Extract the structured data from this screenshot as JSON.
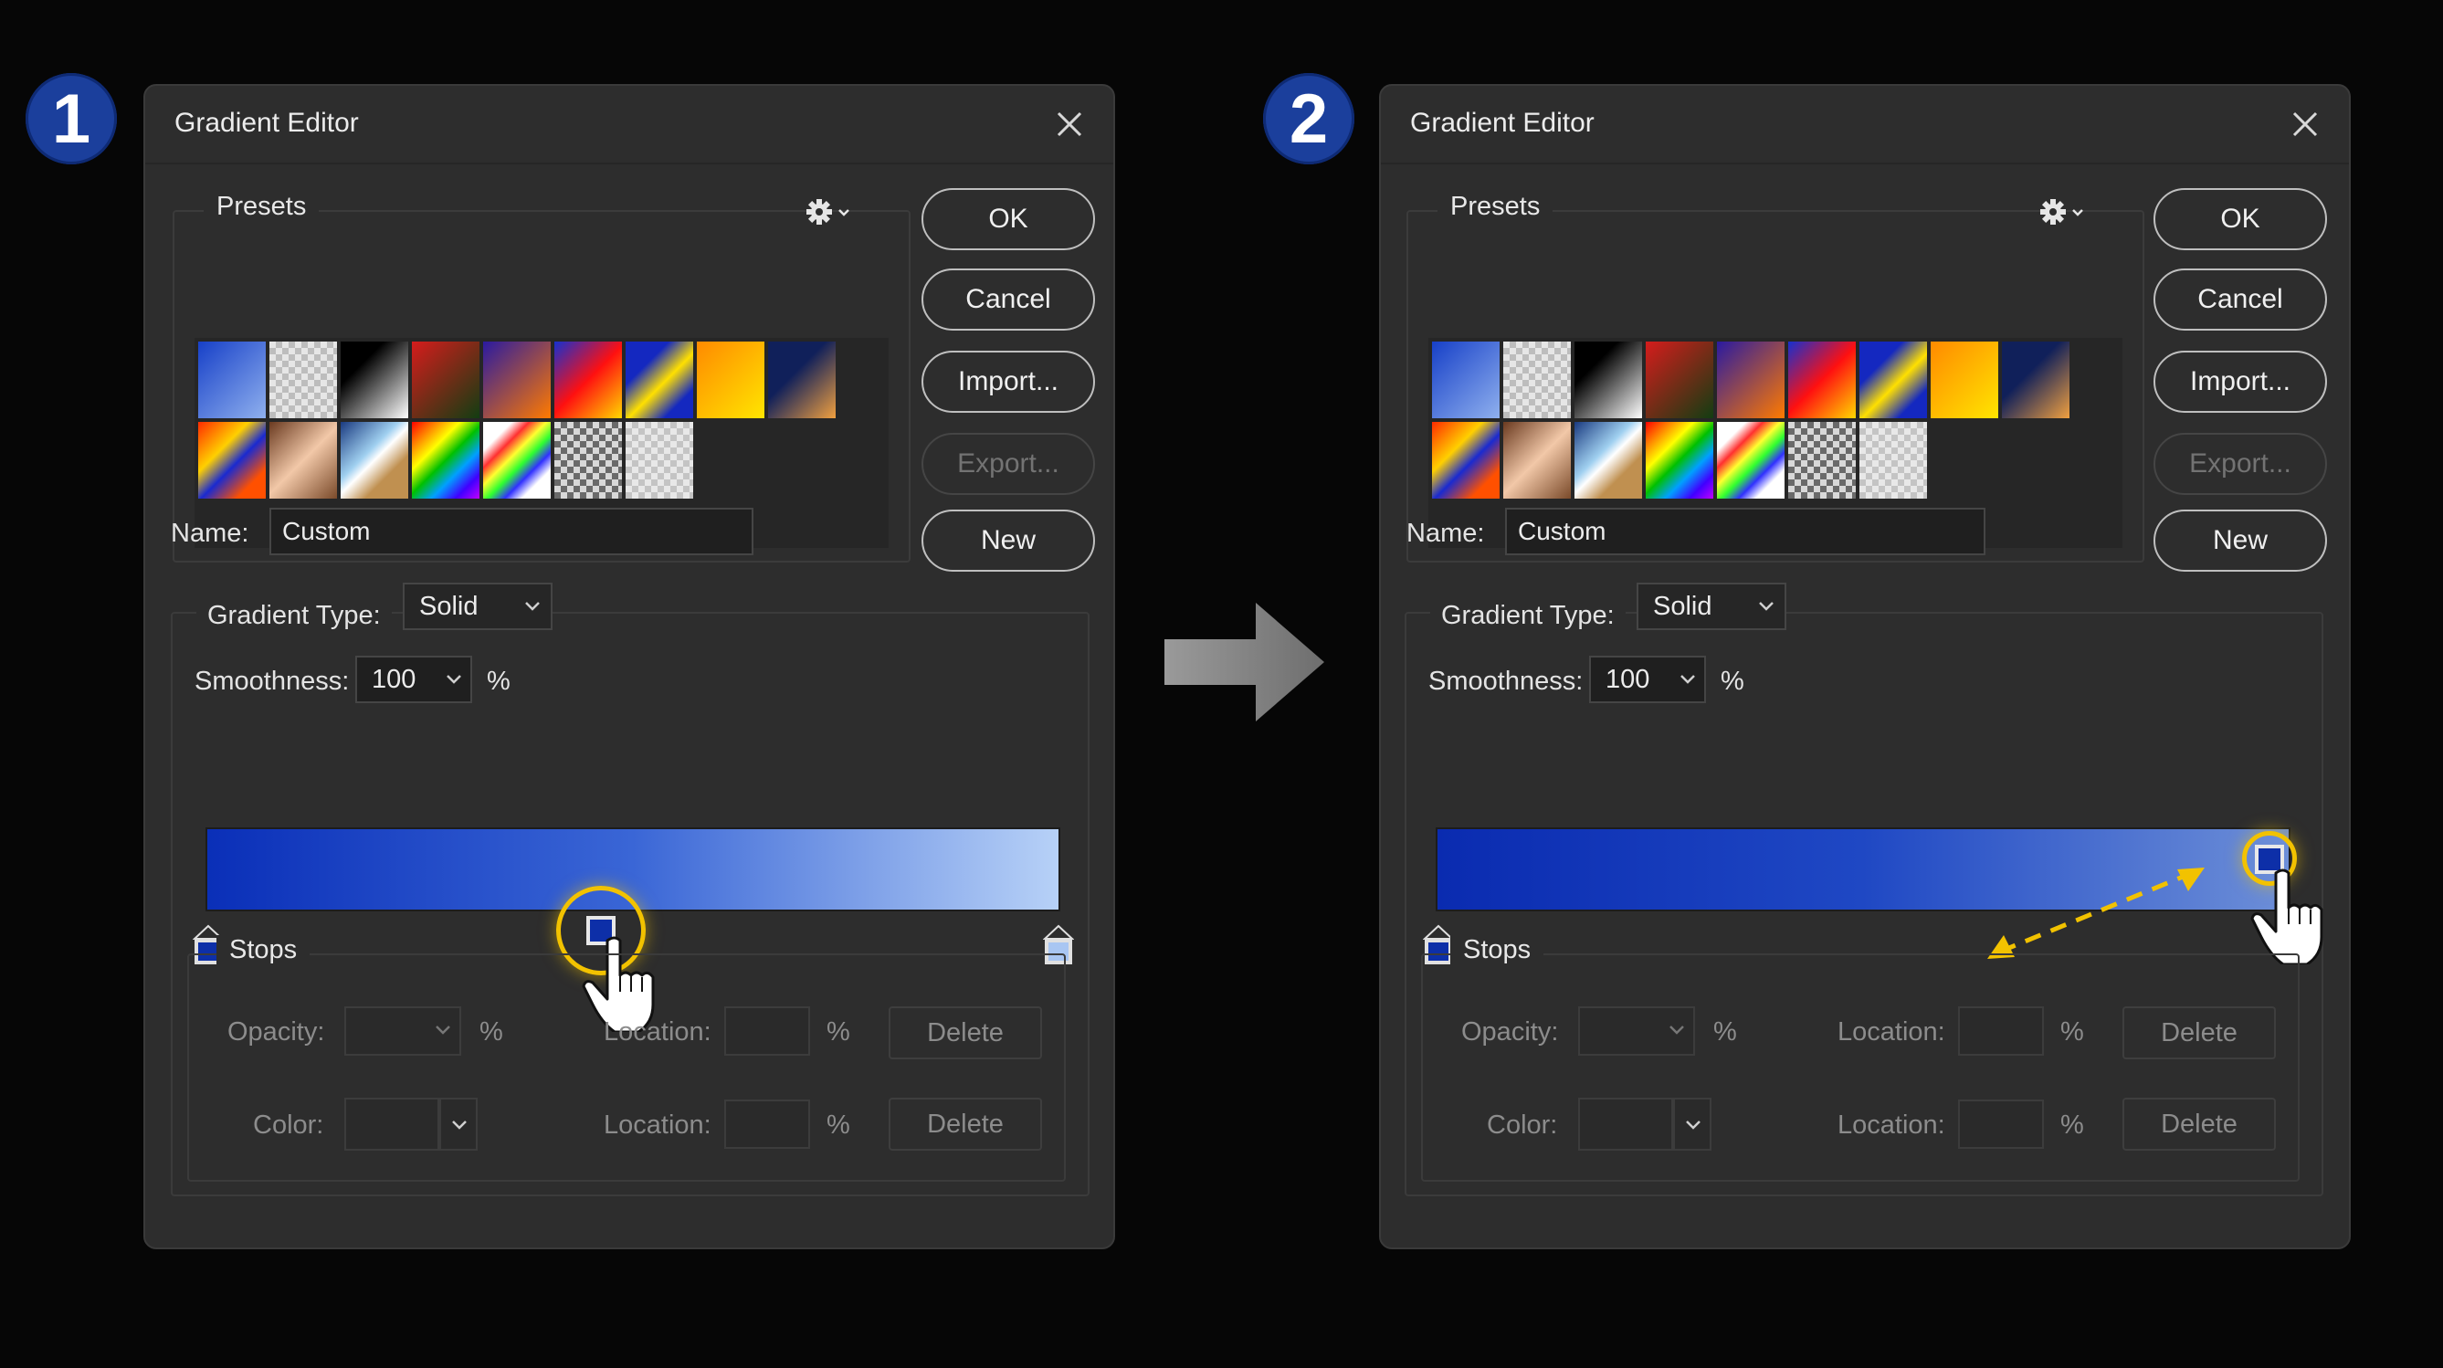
{
  "steps": [
    {
      "badge": "1",
      "dialog": {
        "title": "Gradient Editor",
        "presets_label": "Presets",
        "buttons": {
          "ok": "OK",
          "cancel": "Cancel",
          "import": "Import...",
          "export": "Export...",
          "new": "New"
        },
        "name_label": "Name:",
        "name_value": "Custom",
        "gradient_type_label": "Gradient Type:",
        "gradient_type_value": "Solid",
        "smoothness_label": "Smoothness:",
        "smoothness_value": "100",
        "percent": "%",
        "gradient": {
          "start_color": "#0a2fb8",
          "end_color": "#b7d1f7",
          "midpoint_stop_location": 46
        },
        "stops": {
          "label": "Stops",
          "opacity_label": "Opacity:",
          "color_label": "Color:",
          "location_label": "Location:",
          "delete_label": "Delete"
        }
      }
    },
    {
      "badge": "2",
      "dialog": {
        "title": "Gradient Editor",
        "presets_label": "Presets",
        "buttons": {
          "ok": "OK",
          "cancel": "Cancel",
          "import": "Import...",
          "export": "Export...",
          "new": "New"
        },
        "name_label": "Name:",
        "name_value": "Custom",
        "gradient_type_label": "Gradient Type:",
        "gradient_type_value": "Solid",
        "smoothness_label": "Smoothness:",
        "smoothness_value": "100",
        "percent": "%",
        "gradient": {
          "start_color": "#0a2bb0",
          "end_color": "#6d8fd8",
          "moved_stop_location": 97
        },
        "stops": {
          "label": "Stops",
          "opacity_label": "Opacity:",
          "color_label": "Color:",
          "location_label": "Location:",
          "delete_label": "Delete"
        }
      }
    }
  ],
  "colors": {
    "accent_highlight": "#f2c200",
    "badge_blue": "#1b3f9c",
    "panel_bg": "#2d2d2d"
  },
  "icons": [
    "close-icon",
    "gear-icon",
    "chevron-down-icon",
    "hand-cursor-icon",
    "arrow-right-icon",
    "color-stop-icon"
  ]
}
